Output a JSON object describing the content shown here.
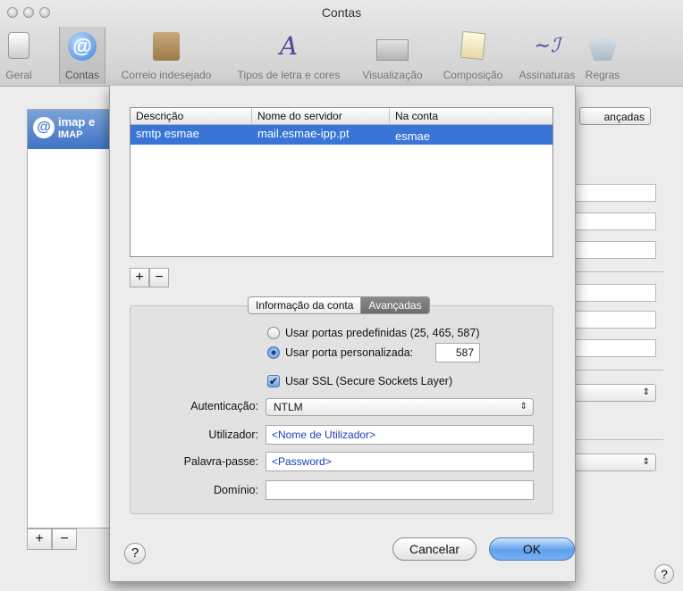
{
  "window": {
    "title": "Contas"
  },
  "toolbar": {
    "items": [
      {
        "label": "Geral",
        "icon": "switch-icon"
      },
      {
        "label": "Contas",
        "icon": "at-icon"
      },
      {
        "label": "Correio indesejado",
        "icon": "junk-mail-icon"
      },
      {
        "label": "Tipos de letra e cores",
        "icon": "font-icon"
      },
      {
        "label": "Visualização",
        "icon": "viewing-icon"
      },
      {
        "label": "Composição",
        "icon": "composing-icon"
      },
      {
        "label": "Assinaturas",
        "icon": "signature-icon"
      },
      {
        "label": "Regras",
        "icon": "rules-icon"
      }
    ],
    "selected": "Contas"
  },
  "background": {
    "account": {
      "name": "imap e",
      "type": "IMAP",
      "icon_glyph": "@"
    },
    "tab_partial": "ançadas",
    "add_label": "+",
    "remove_label": "−",
    "help_label": "?"
  },
  "sheet": {
    "table": {
      "columns": [
        "Descrição",
        "Nome do servidor",
        "Na conta"
      ],
      "rows": [
        {
          "descricao": "smtp esmae",
          "servidor": "mail.esmae-ipp.pt",
          "conta": "esmae",
          "selected": true
        }
      ]
    },
    "add_label": "+",
    "remove_label": "−",
    "tabs": {
      "info": "Informação da conta",
      "advanced": "Avançadas",
      "active": "Avançadas"
    },
    "ports": {
      "default_label": "Usar portas predefinidas (25, 465, 587)",
      "custom_label": "Usar porta personalizada:",
      "selected": "custom",
      "custom_value": "587"
    },
    "ssl": {
      "label": "Usar SSL (Secure Sockets Layer)",
      "checked": true,
      "check_glyph": "✔"
    },
    "auth": {
      "label": "Autenticação:",
      "value": "NTLM",
      "arrows": "⇕"
    },
    "user": {
      "label": "Utilizador:",
      "value": "<Nome de Utilizador>"
    },
    "password": {
      "label": "Palavra-passe:",
      "value": "<Password>"
    },
    "domain": {
      "label": "Domínio:",
      "value": ""
    },
    "help_label": "?",
    "cancel_label": "Cancelar",
    "ok_label": "OK"
  },
  "colors": {
    "selection": "#3875d7",
    "default_button": "#5fa0ec"
  }
}
